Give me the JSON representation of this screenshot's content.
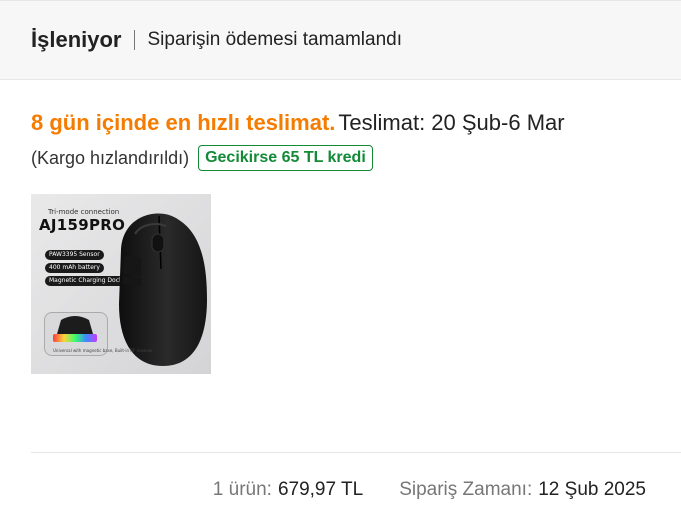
{
  "status": {
    "title": "İşleniyor",
    "description": "Siparişin ödemesi tamamlandı"
  },
  "delivery": {
    "fast_text": "8 gün içinde en hızlı teslimat.",
    "delivery_text": "Teslimat: 20 Şub-6 Mar",
    "cargo_text": "(Kargo hızlandırıldı)",
    "credit_badge": "Gecikirse 65 TL kredi"
  },
  "product": {
    "image_text": {
      "connection": "Tri-mode connection",
      "model": "AJ159PRO",
      "features": [
        "PAW3395 Sensor",
        "400 mAh battery",
        "Magnetic Charging Dock"
      ],
      "dock_caption": "Universal with magnetic base, Built-in RF receiver"
    }
  },
  "summary": {
    "items_label": "1 ürün:",
    "items_total": "679,97 TL",
    "order_time_label": "Sipariş Zamanı:",
    "order_time": "12 Şub 2025"
  },
  "colors": {
    "accent_orange": "#F57C00",
    "credit_green": "#138A36",
    "mouse_body": "#1c1c1c",
    "muted_text": "#777777"
  }
}
